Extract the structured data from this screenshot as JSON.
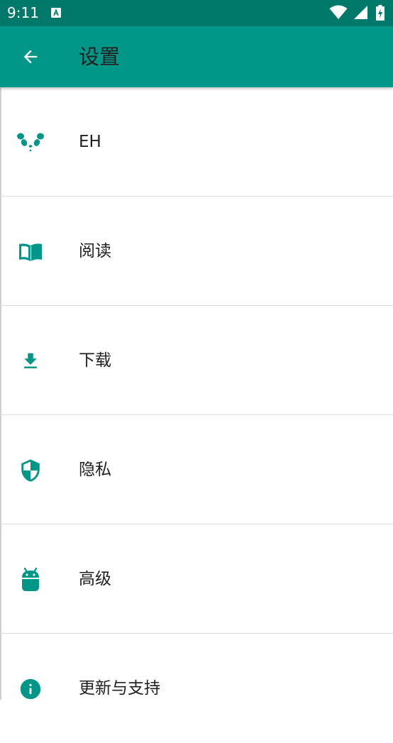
{
  "status_bar": {
    "time": "9:11",
    "notification_icon": "a-letter-icon",
    "wifi_icon": "wifi-icon",
    "signal_icon": "cell-signal-icon",
    "battery_icon": "battery-charging-icon"
  },
  "app_bar": {
    "back_icon": "arrow-back-icon",
    "title": "设置",
    "color": "#009688"
  },
  "settings": {
    "accent_color": "#009688",
    "items": [
      {
        "label": "EH",
        "icon": "panda-icon"
      },
      {
        "label": "阅读",
        "icon": "book-icon"
      },
      {
        "label": "下载",
        "icon": "download-icon"
      },
      {
        "label": "隐私",
        "icon": "shield-icon"
      },
      {
        "label": "高级",
        "icon": "android-icon"
      },
      {
        "label": "更新与支持",
        "icon": "info-icon"
      }
    ]
  }
}
